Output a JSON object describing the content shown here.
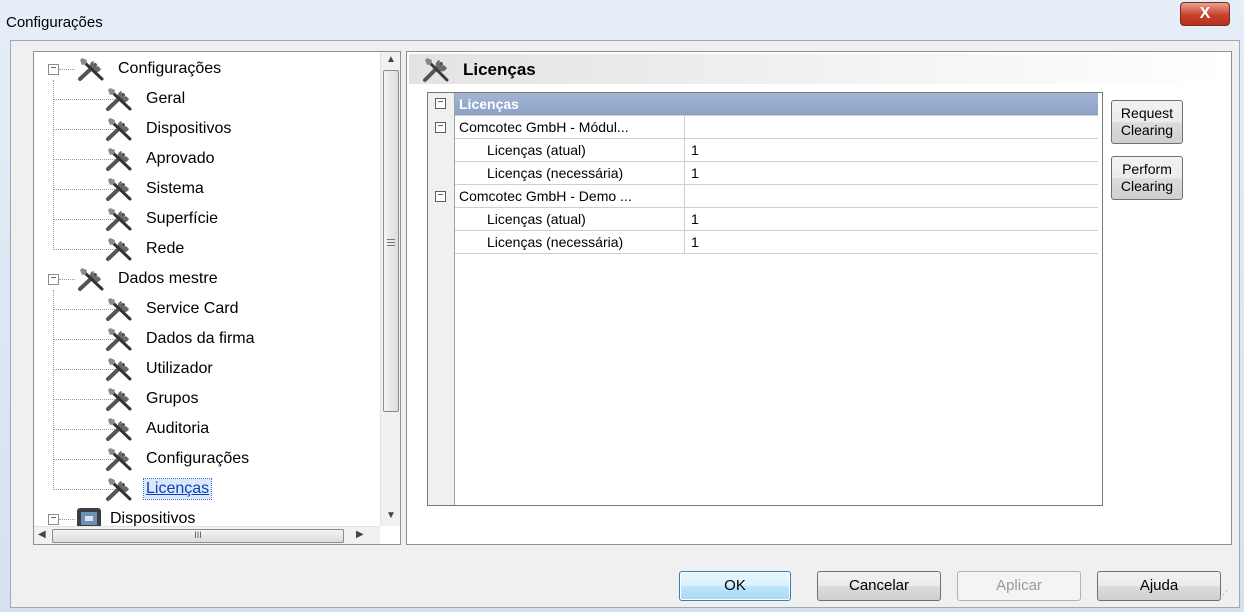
{
  "window": {
    "title": "Configurações",
    "close_glyph": "X"
  },
  "tree": {
    "items": [
      {
        "label": "Configurações",
        "level": 0,
        "icon": "tools-icon",
        "expander": "minus"
      },
      {
        "label": "Geral",
        "level": 1,
        "icon": "tools-icon"
      },
      {
        "label": "Dispositivos",
        "level": 1,
        "icon": "tools-icon"
      },
      {
        "label": "Aprovado",
        "level": 1,
        "icon": "tools-icon"
      },
      {
        "label": "Sistema",
        "level": 1,
        "icon": "tools-icon"
      },
      {
        "label": "Superfície",
        "level": 1,
        "icon": "tools-icon"
      },
      {
        "label": "Rede",
        "level": 1,
        "icon": "tools-icon"
      },
      {
        "label": "Dados mestre",
        "level": 0,
        "icon": "tools-icon",
        "expander": "minus"
      },
      {
        "label": "Service Card",
        "level": 1,
        "icon": "tools-icon"
      },
      {
        "label": "Dados da firma",
        "level": 1,
        "icon": "tools-icon"
      },
      {
        "label": "Utilizador",
        "level": 1,
        "icon": "tools-icon"
      },
      {
        "label": "Grupos",
        "level": 1,
        "icon": "tools-icon"
      },
      {
        "label": "Auditoria",
        "level": 1,
        "icon": "tools-icon"
      },
      {
        "label": "Configurações",
        "level": 1,
        "icon": "tools-icon"
      },
      {
        "label": "Licenças",
        "level": 1,
        "icon": "tools-icon",
        "selected": true
      },
      {
        "label": "Dispositivos",
        "level": 0,
        "icon": "device-icon",
        "expander": "minus"
      }
    ],
    "hscroll_thumb_glyph": "III"
  },
  "panel": {
    "title": "Licenças",
    "grid": {
      "header": "Licenças",
      "rows": [
        {
          "type": "group",
          "name": "Comcotec GmbH - Módul...",
          "value": ""
        },
        {
          "type": "item",
          "name": "Licenças (atual)",
          "value": "1"
        },
        {
          "type": "item",
          "name": "Licenças (necessária)",
          "value": "1"
        },
        {
          "type": "group",
          "name": "Comcotec GmbH - Demo ...",
          "value": ""
        },
        {
          "type": "item",
          "name": "Licenças (atual)",
          "value": "1"
        },
        {
          "type": "item",
          "name": "Licenças (necessária)",
          "value": "1"
        }
      ]
    },
    "buttons": [
      {
        "label_line1": "Request",
        "label_line2": "Clearing"
      },
      {
        "label_line1": "Perform",
        "label_line2": "Clearing"
      }
    ]
  },
  "footer": {
    "ok_label": "OK",
    "cancel_label": "Cancelar",
    "apply_label": "Aplicar",
    "help_label": "Ajuda"
  },
  "colors": {
    "grid_header": "#8aa1c6",
    "selection": "#0b3db7",
    "close_button": "#c8412b"
  }
}
